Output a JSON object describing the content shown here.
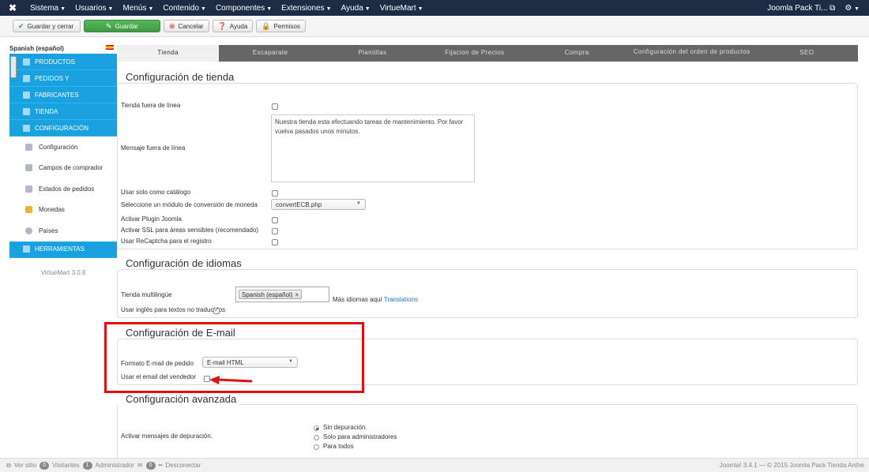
{
  "navbar": {
    "menu": [
      {
        "label": "Sistema"
      },
      {
        "label": "Usuarios"
      },
      {
        "label": "Menús"
      },
      {
        "label": "Contenido"
      },
      {
        "label": "Componentes"
      },
      {
        "label": "Extensiones"
      },
      {
        "label": "Ayuda"
      },
      {
        "label": "VirtueMart"
      }
    ],
    "site_name": "Joomla Pack Ti...",
    "icons": {
      "logo": "joomla-logo",
      "external": "external-link-icon",
      "gear": "gear-icon"
    }
  },
  "toolbar": {
    "save_close": "Guardar y cerrar",
    "save": "Guardar",
    "cancel": "Cancelar",
    "help": "Ayuda",
    "permissions": "Permisos"
  },
  "sidebar": {
    "language": "Spanish (español)",
    "sections_top": [
      "PRODUCTOS",
      "PEDIDOS Y",
      "FABRICANTES",
      "TIENDA",
      "CONFIGURACIÓN"
    ],
    "config_items": [
      "Configuración",
      "Campos de comprador",
      "Estados de pedidos",
      "Monedas",
      "Países"
    ],
    "tools": "HERRAMIENTAS",
    "version": "VirtueMart 3.0.8"
  },
  "tabs": [
    {
      "label": "Tienda",
      "active": true
    },
    {
      "label": "Escaparate"
    },
    {
      "label": "Plantillas"
    },
    {
      "label": "Fijacion de Precios"
    },
    {
      "label": "Compra"
    },
    {
      "label": "Configuración del orden de productos"
    },
    {
      "label": "SEO"
    }
  ],
  "shop": {
    "legend": "Configuración de tienda",
    "offline": "Tienda fuera de línea",
    "offline_message_label": "Mensaje fuera de línea",
    "offline_message": "Nuestra tienda esta efectuando tareas de mantenimiento. Por favor vuelva pasados unos minutos.",
    "catalog_only": "Usar solo como catálogo",
    "currency_module": "Seleccione un módulo de conversión de moneda",
    "currency_module_value": "convertECB.php",
    "joomla_plugin": "Activar Plugin Joomla",
    "ssl": "Activar SSL para áreas sensibles (recomendado)",
    "recaptcha": "Usar ReCaptcha para el registro"
  },
  "languages": {
    "legend": "Configuración de idiomas",
    "multilingual": "Tienda multilingüe",
    "chip": "Spanish (español)",
    "more_text": "Más idiomas aquí",
    "more_link": "Translations",
    "use_english": "Usar inglés para textos no traducidos"
  },
  "email": {
    "legend": "Configuración de E-mail",
    "format": "Formato E-mail de pedido",
    "format_value": "E-mail HTML",
    "vendor_email": "Usar el email del vendedor"
  },
  "advanced": {
    "legend": "Configuración avanzada",
    "debug": "Activar mensajes de depuración.",
    "options": [
      "Sin depuración.",
      "Solo para administradores",
      "Para todos"
    ]
  },
  "footer": {
    "view_site": "Ver sitio",
    "visitors_count": "0",
    "visitors": "Visitantes",
    "admin_count": "1",
    "admin": "Administrador",
    "msg_count": "0",
    "logout": "Desconectar",
    "copyright": "Joomla! 3.4.1 — © 2015 Joomla Pack Tienda Anthe"
  },
  "colors": {
    "accent": "#1aa1e0",
    "navbar": "#1d2b45",
    "annotation": "#e01010"
  }
}
